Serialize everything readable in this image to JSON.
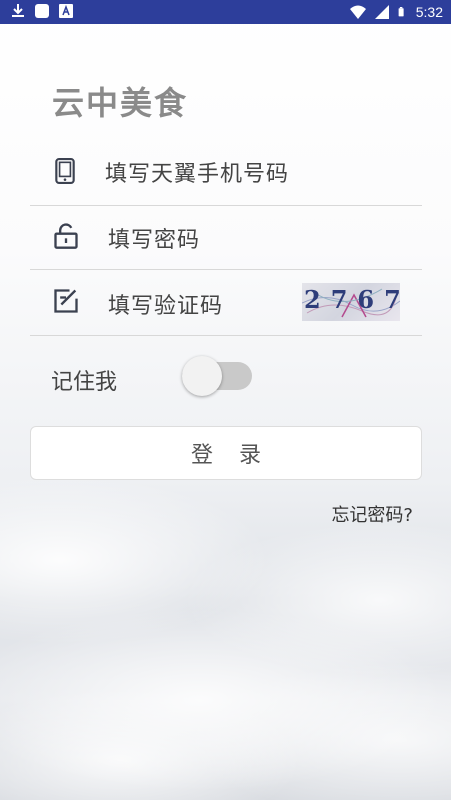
{
  "status_bar": {
    "time": "5:32",
    "icons": [
      "download-icon",
      "app-icon",
      "notification-icon",
      "wifi-icon",
      "signal-icon",
      "battery-icon"
    ]
  },
  "app": {
    "title": "云中美食"
  },
  "form": {
    "phone_placeholder": "填写天翼手机号码",
    "password_placeholder": "填写密码",
    "captcha_placeholder": "填写验证码",
    "captcha_code": "2767",
    "remember_label": "记住我",
    "remember_checked": false,
    "login_label": "登录",
    "forgot_label": "忘记密码?"
  },
  "colors": {
    "status_bar": "#2d3e9b",
    "title": "#8a8a8a",
    "text": "#444444",
    "divider": "#d8d8d8"
  }
}
